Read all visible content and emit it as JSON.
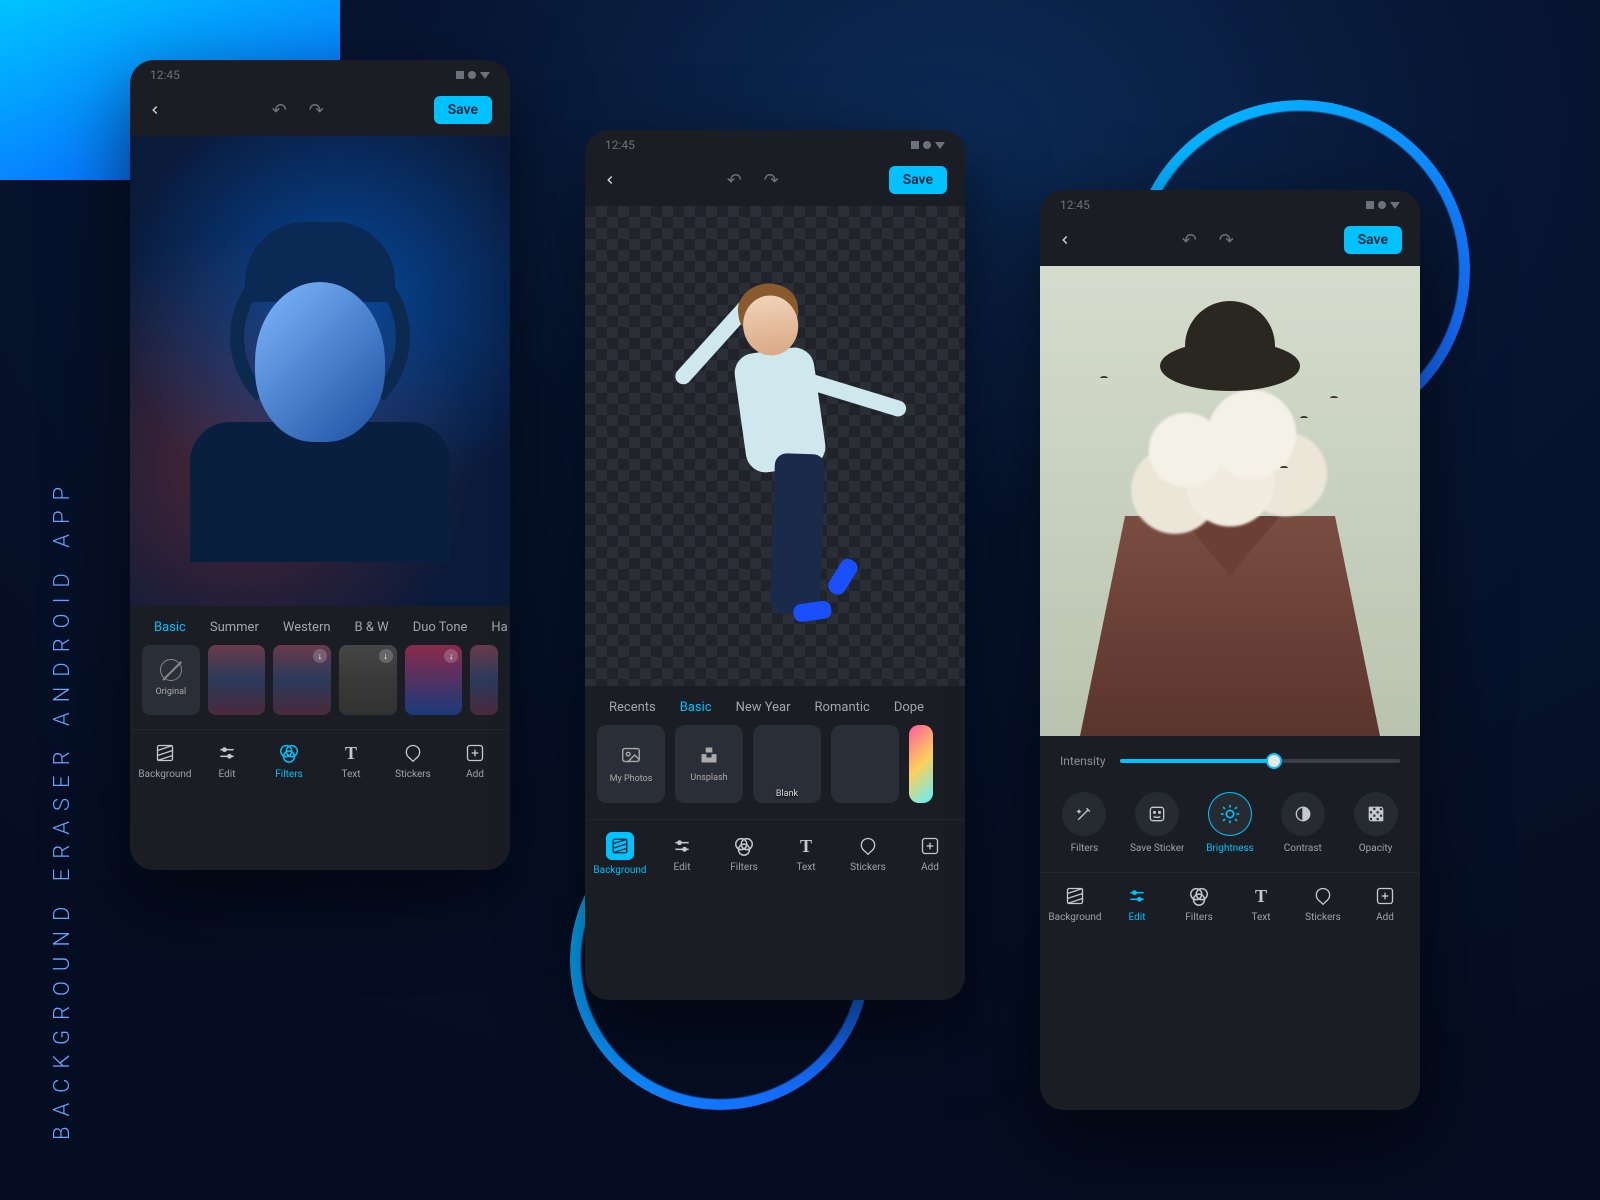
{
  "side_title": "BACKGROUND ERASER ANDROID APP",
  "status_time": "12:45",
  "topbar": {
    "save_label": "Save"
  },
  "phone1": {
    "filter_tabs": [
      "Basic",
      "Summer",
      "Western",
      "B & W",
      "Duo Tone",
      "Ha"
    ],
    "filter_tabs_active": 0,
    "thumbs": [
      {
        "label": "Original",
        "kind": "original"
      },
      {
        "label": "",
        "kind": "img"
      },
      {
        "label": "",
        "kind": "img",
        "dl": true
      },
      {
        "label": "",
        "kind": "bw",
        "dl": true
      },
      {
        "label": "",
        "kind": "duo",
        "dl": true
      },
      {
        "label": "",
        "kind": "img"
      }
    ],
    "nav_active": 2
  },
  "phone2": {
    "bg_tabs": [
      "Recents",
      "Basic",
      "New Year",
      "Romantic",
      "Dope"
    ],
    "bg_tabs_active": 1,
    "thumbs": [
      {
        "label": "My Photos",
        "icon": "image"
      },
      {
        "label": "Unsplash",
        "icon": "unsplash"
      },
      {
        "label": "Blank",
        "icon": "trans"
      },
      {
        "label": "",
        "icon": "sunset"
      },
      {
        "label": "",
        "icon": "gradient"
      }
    ],
    "nav_active": 0
  },
  "phone3": {
    "intensity_label": "Intensity",
    "intensity_value": 55,
    "adjust": [
      {
        "label": "Filters",
        "icon": "wand"
      },
      {
        "label": "Save Sticker",
        "icon": "sticker"
      },
      {
        "label": "Brightness",
        "icon": "sun"
      },
      {
        "label": "Contrast",
        "icon": "contrast"
      },
      {
        "label": "Opacity",
        "icon": "opacity"
      }
    ],
    "adjust_active": 2,
    "nav_active": 1
  },
  "nav": [
    {
      "label": "Background",
      "icon": "bg"
    },
    {
      "label": "Edit",
      "icon": "sliders"
    },
    {
      "label": "Filters",
      "icon": "venn"
    },
    {
      "label": "Text",
      "icon": "T"
    },
    {
      "label": "Stickers",
      "icon": "tag"
    },
    {
      "label": "Add",
      "icon": "plus"
    }
  ]
}
